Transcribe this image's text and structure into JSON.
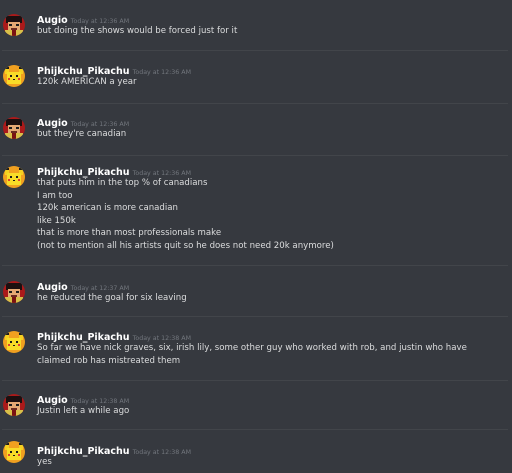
{
  "channel": {
    "messages": [
      {
        "author": "Augio",
        "avatar": "augio-pixel-avatar",
        "timestamp": "Today at 12:36 AM",
        "lines": [
          "but doing the shows would be forced just for it"
        ]
      },
      {
        "author": "Phijkchu_Pikachu",
        "avatar": "pikachu-pixel-avatar",
        "timestamp": "Today at 12:36 AM",
        "lines": [
          "120k AMERICAN a year"
        ]
      },
      {
        "author": "Augio",
        "avatar": "augio-pixel-avatar",
        "timestamp": "Today at 12:36 AM",
        "lines": [
          "but they're canadian"
        ]
      },
      {
        "author": "Phijkchu_Pikachu",
        "avatar": "pikachu-pixel-avatar",
        "timestamp": "Today at 12:36 AM",
        "lines": [
          "that puts him in the top % of canadians",
          "I am too",
          "120k american is more canadian",
          "like 150k",
          "that is more than most professionals make",
          "(not to mention all his artists quit so he does not need 20k anymore)"
        ]
      },
      {
        "author": "Augio",
        "avatar": "augio-pixel-avatar",
        "timestamp": "Today at 12:37 AM",
        "lines": [
          "he reduced the goal for six leaving"
        ]
      },
      {
        "author": "Phijkchu_Pikachu",
        "avatar": "pikachu-pixel-avatar",
        "timestamp": "Today at 12:38 AM",
        "lines": [
          "So far we have nick graves, six, irish lily, some other guy who worked with rob, and justin who have claimed rob has mistreated them"
        ]
      },
      {
        "author": "Augio",
        "avatar": "augio-pixel-avatar",
        "timestamp": "Today at 12:38 AM",
        "lines": [
          "Justin left a while ago"
        ]
      },
      {
        "author": "Phijkchu_Pikachu",
        "avatar": "pikachu-pixel-avatar",
        "timestamp": "Today at 12:38 AM",
        "lines": [
          "yes"
        ]
      }
    ]
  },
  "colors": {
    "background": "#36393f",
    "author": "#ffffff",
    "text": "#dcddde",
    "timestamp": "#72767d",
    "divider": "#42454a"
  }
}
